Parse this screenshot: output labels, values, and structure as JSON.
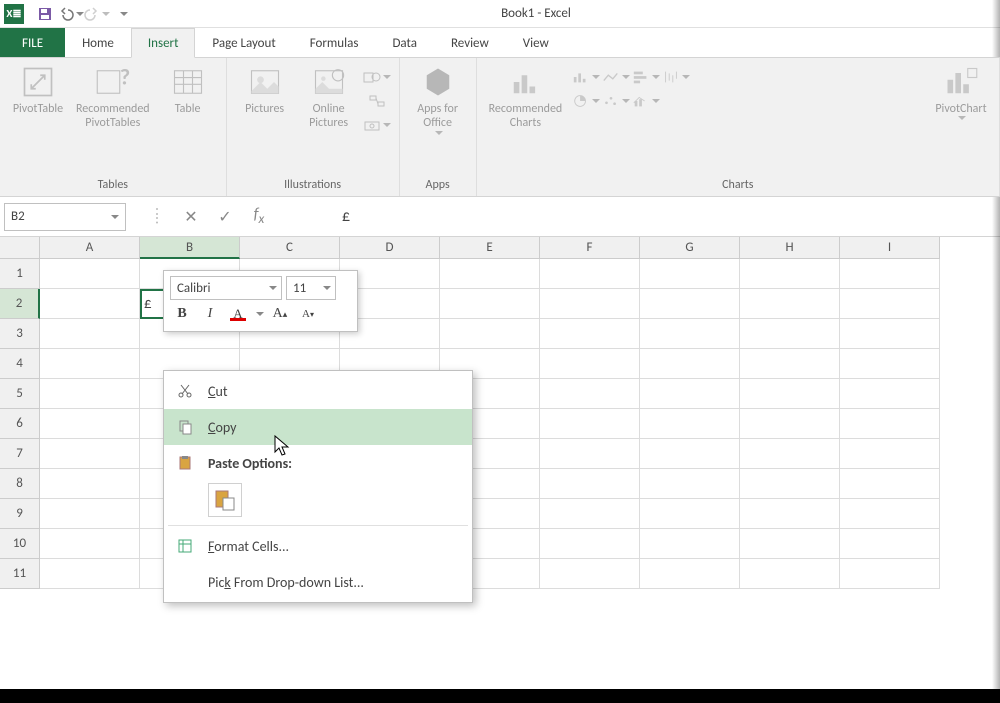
{
  "title": "Book1 - Excel",
  "tabs": {
    "file": "FILE",
    "items": [
      "Home",
      "Insert",
      "Page Layout",
      "Formulas",
      "Data",
      "Review",
      "View"
    ],
    "active": "Insert"
  },
  "ribbon": {
    "tables": {
      "label": "Tables",
      "pivot": "PivotTable",
      "recPivot": "Recommended\nPivotTables",
      "table": "Table"
    },
    "illustrations": {
      "label": "Illustrations",
      "pictures": "Pictures",
      "online": "Online\nPictures"
    },
    "apps": {
      "label": "Apps",
      "apps": "Apps for\nOffice"
    },
    "charts": {
      "label": "Charts",
      "rec": "Recommended\nCharts",
      "pivotchart": "PivotChart"
    }
  },
  "formulaBar": {
    "nameBox": "B2",
    "formula": "£"
  },
  "grid": {
    "columns": [
      "A",
      "B",
      "C",
      "D",
      "E",
      "F",
      "G",
      "H",
      "I"
    ],
    "rows": [
      "1",
      "2",
      "3",
      "4",
      "5",
      "6",
      "7",
      "8",
      "9",
      "10",
      "11"
    ],
    "selCol": "B",
    "selRow": "2",
    "b2": "£"
  },
  "miniToolbar": {
    "font": "Calibri",
    "size": "11"
  },
  "contextMenu": {
    "cut": "Cut",
    "copy": "Copy",
    "pasteHeader": "Paste Options:",
    "format": "Format Cells...",
    "pick": "Pick From Drop-down List..."
  }
}
